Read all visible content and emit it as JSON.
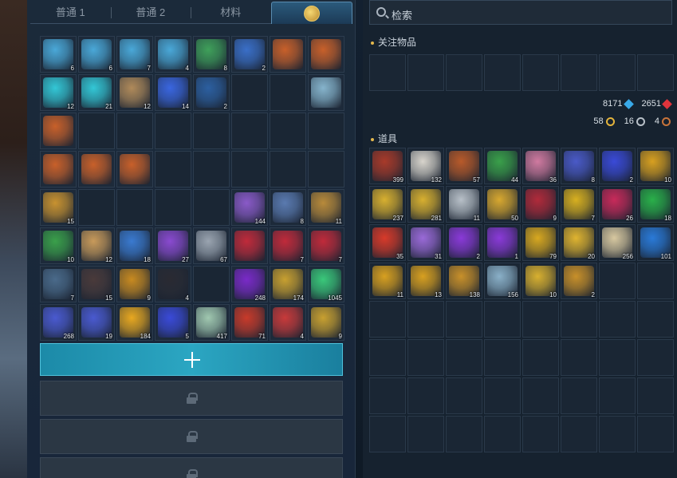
{
  "tabs": [
    {
      "label": "普通 1"
    },
    {
      "label": "普通 2"
    },
    {
      "label": "材料"
    },
    {
      "label": "",
      "icon": "special-bag-icon"
    }
  ],
  "left_items": [
    {
      "icon": "skill-rune-icon",
      "color": "#4aa8d8",
      "qty": "6"
    },
    {
      "icon": "skill-rune-icon",
      "color": "#4aa8d8",
      "qty": "6"
    },
    {
      "icon": "skill-rune-icon",
      "color": "#4aa8d8",
      "qty": "7"
    },
    {
      "icon": "skill-rune-icon",
      "color": "#4aa8d8",
      "qty": "4"
    },
    {
      "icon": "treasure-chest-icon",
      "color": "#3fa05a",
      "qty": "8"
    },
    {
      "icon": "treasure-chest-icon",
      "color": "#3a6fc8",
      "qty": "2"
    },
    {
      "icon": "hammer-scroll-icon",
      "color": "#c8602a",
      "qty": ""
    },
    {
      "icon": "hammer-scroll-icon",
      "color": "#c8602a",
      "qty": ""
    },
    {
      "icon": "cyan-orb-icon",
      "color": "#33c7d6",
      "qty": "12"
    },
    {
      "icon": "cyan-orb-icon",
      "color": "#33c7d6",
      "qty": "21"
    },
    {
      "icon": "bow-icon",
      "color": "#b08a5a",
      "qty": "12"
    },
    {
      "icon": "blue-crystal-icon",
      "color": "#3a66e0",
      "qty": "14"
    },
    {
      "icon": "dark-armor-icon",
      "color": "#2c5fa0",
      "qty": "2"
    },
    {
      "icon": "",
      "color": "",
      "qty": ""
    },
    {
      "icon": "",
      "color": "",
      "qty": ""
    },
    {
      "icon": "light-orb-icon",
      "color": "#86b4cc",
      "qty": ""
    },
    {
      "icon": "hammer-scroll-icon",
      "color": "#c8602a",
      "qty": ""
    },
    {
      "icon": "",
      "color": "",
      "qty": ""
    },
    {
      "icon": "",
      "color": "",
      "qty": ""
    },
    {
      "icon": "",
      "color": "",
      "qty": ""
    },
    {
      "icon": "",
      "color": "",
      "qty": ""
    },
    {
      "icon": "",
      "color": "",
      "qty": ""
    },
    {
      "icon": "",
      "color": "",
      "qty": ""
    },
    {
      "icon": "",
      "color": "",
      "qty": ""
    },
    {
      "icon": "hammer-scroll-icon",
      "color": "#c8602a",
      "qty": ""
    },
    {
      "icon": "hammer-scroll-icon",
      "color": "#c8602a",
      "qty": ""
    },
    {
      "icon": "hammer-scroll-icon",
      "color": "#c8602a",
      "qty": ""
    },
    {
      "icon": "",
      "color": "",
      "qty": ""
    },
    {
      "icon": "",
      "color": "",
      "qty": ""
    },
    {
      "icon": "",
      "color": "",
      "qty": ""
    },
    {
      "icon": "",
      "color": "",
      "qty": ""
    },
    {
      "icon": "",
      "color": "",
      "qty": ""
    },
    {
      "icon": "golden-lantern-icon",
      "color": "#c89230",
      "qty": "15"
    },
    {
      "icon": "",
      "color": "",
      "qty": ""
    },
    {
      "icon": "",
      "color": "",
      "qty": ""
    },
    {
      "icon": "",
      "color": "",
      "qty": ""
    },
    {
      "icon": "",
      "color": "",
      "qty": ""
    },
    {
      "icon": "purple-cannon-icon",
      "color": "#8a5ac8",
      "qty": "144"
    },
    {
      "icon": "blue-cannon-icon",
      "color": "#5a7ab0",
      "qty": "8"
    },
    {
      "icon": "gold-cannon-icon",
      "color": "#b88a3a",
      "qty": "11"
    },
    {
      "icon": "green-tunic-icon",
      "color": "#3aa04a",
      "qty": "10"
    },
    {
      "icon": "tan-tunic-icon",
      "color": "#c89a5a",
      "qty": "12"
    },
    {
      "icon": "blue-tunic-icon",
      "color": "#3a7ad0",
      "qty": "18"
    },
    {
      "icon": "purple-tunic-icon",
      "color": "#8a4ad0",
      "qty": "27"
    },
    {
      "icon": "white-tunic-icon",
      "color": "#9aa4b0",
      "qty": "67"
    },
    {
      "icon": "red-staff-icon",
      "color": "#c02a3a",
      "qty": ""
    },
    {
      "icon": "red-staff-icon",
      "color": "#c02a3a",
      "qty": "7"
    },
    {
      "icon": "red-staff-icon",
      "color": "#c02a3a",
      "qty": "7"
    },
    {
      "icon": "feather-icon",
      "color": "#4a6a8a",
      "qty": "7"
    },
    {
      "icon": "dark-gauntlet-icon",
      "color": "#4a3a3a",
      "qty": "15"
    },
    {
      "icon": "amber-amulet-icon",
      "color": "#c88a20",
      "qty": "9"
    },
    {
      "icon": "black-orb-icon",
      "color": "#2a2a32",
      "qty": "4"
    },
    {
      "icon": "",
      "color": "",
      "qty": ""
    },
    {
      "icon": "purple-sphere-icon",
      "color": "#7a2ac8",
      "qty": "248"
    },
    {
      "icon": "gold-tank-icon",
      "color": "#c8a030",
      "qty": "174"
    },
    {
      "icon": "green-crystal-icon",
      "color": "#3ac87a",
      "qty": "1045"
    },
    {
      "icon": "blue-frame-scroll-icon",
      "color": "#4a5ad0",
      "qty": "268"
    },
    {
      "icon": "blue-frame-scroll-icon",
      "color": "#4a5ad0",
      "qty": "19"
    },
    {
      "icon": "sun-star-icon",
      "color": "#e8a820",
      "qty": "184"
    },
    {
      "icon": "magic-circle-icon",
      "color": "#3a4ad8",
      "qty": "5"
    },
    {
      "icon": "fortune-coin-icon",
      "color": "#a0c8b0",
      "qty": "417"
    },
    {
      "icon": "ruby-pendant-icon",
      "color": "#c83a2a",
      "qty": "71"
    },
    {
      "icon": "red-scroll-icon",
      "color": "#c83a3a",
      "qty": "4"
    },
    {
      "icon": "gold-bell-icon",
      "color": "#c8a030",
      "qty": "9"
    }
  ],
  "expand_label": "",
  "search": {
    "placeholder": "检索"
  },
  "watch_title": "关注物品",
  "items_title": "道具",
  "currency": {
    "blue_gem": "8171",
    "red_gem": "2651",
    "gold_coin": "58",
    "silver_coin": "16",
    "bronze_coin": "4",
    "colors": {
      "blue_gem": "#39a9e8",
      "red_gem": "#e0343c",
      "gold": "#e4b43c",
      "silver": "#b8c0c8",
      "bronze": "#c8743a"
    }
  },
  "right_items": [
    {
      "icon": "red-jar-icon",
      "color": "#a83a2a",
      "qty": "399"
    },
    {
      "icon": "steamed-bun-icon",
      "color": "#d8d4cc",
      "qty": "132"
    },
    {
      "icon": "roast-meat-icon",
      "color": "#b85a2a",
      "qty": "57"
    },
    {
      "icon": "green-potion-icon",
      "color": "#3aa04a",
      "qty": "44"
    },
    {
      "icon": "pink-potion-icon",
      "color": "#d07aa0",
      "qty": "36"
    },
    {
      "icon": "ornate-box-icon",
      "color": "#4a5ac8",
      "qty": "8"
    },
    {
      "icon": "crystal-ball-icon",
      "color": "#3a4ad8",
      "qty": "2"
    },
    {
      "icon": "gold-scroll-icon",
      "color": "#d8a020",
      "qty": "10"
    },
    {
      "icon": "gold-hammer-icon",
      "color": "#d8b030",
      "qty": "237"
    },
    {
      "icon": "gold-hammer-icon",
      "color": "#d8b030",
      "qty": "281"
    },
    {
      "icon": "silver-key-icon",
      "color": "#b8c0c8",
      "qty": "11"
    },
    {
      "icon": "gold-key-icon",
      "color": "#d8a830",
      "qty": "50"
    },
    {
      "icon": "red-staff-icon",
      "color": "#b02a3a",
      "qty": "9"
    },
    {
      "icon": "gold-talisman-icon",
      "color": "#d8b020",
      "qty": "7"
    },
    {
      "icon": "red-lantern-icon",
      "color": "#c82a5a",
      "qty": "26"
    },
    {
      "icon": "green-chest-icon",
      "color": "#2ab04a",
      "qty": "18"
    },
    {
      "icon": "red-flask-icon",
      "color": "#d83a2a",
      "qty": "35"
    },
    {
      "icon": "purple-wing-icon",
      "color": "#9a6ad8",
      "qty": "31"
    },
    {
      "icon": "purple-crystal-icon",
      "color": "#8a3ad8",
      "qty": "2"
    },
    {
      "icon": "purple-crystal-icon",
      "color": "#8a3ad8",
      "qty": "1"
    },
    {
      "icon": "gold-crown-icon",
      "color": "#d8a820",
      "qty": "79"
    },
    {
      "icon": "gold-crown-icon",
      "color": "#e0b430",
      "qty": "20"
    },
    {
      "icon": "seashell-icon",
      "color": "#d8c8a0",
      "qty": "256"
    },
    {
      "icon": "blue-chest-icon",
      "color": "#2a7ad8",
      "qty": "101"
    },
    {
      "icon": "gold-scroll-icon",
      "color": "#d8a020",
      "qty": "11"
    },
    {
      "icon": "gold-scroll-icon",
      "color": "#d8a020",
      "qty": "13"
    },
    {
      "icon": "gold-fish-icon",
      "color": "#c8902a",
      "qty": "138"
    },
    {
      "icon": "silver-fish-icon",
      "color": "#8ab0c8",
      "qty": "156"
    },
    {
      "icon": "gold-horn-icon",
      "color": "#d8b030",
      "qty": "10"
    },
    {
      "icon": "gold-coil-icon",
      "color": "#c8902a",
      "qty": "2"
    }
  ]
}
